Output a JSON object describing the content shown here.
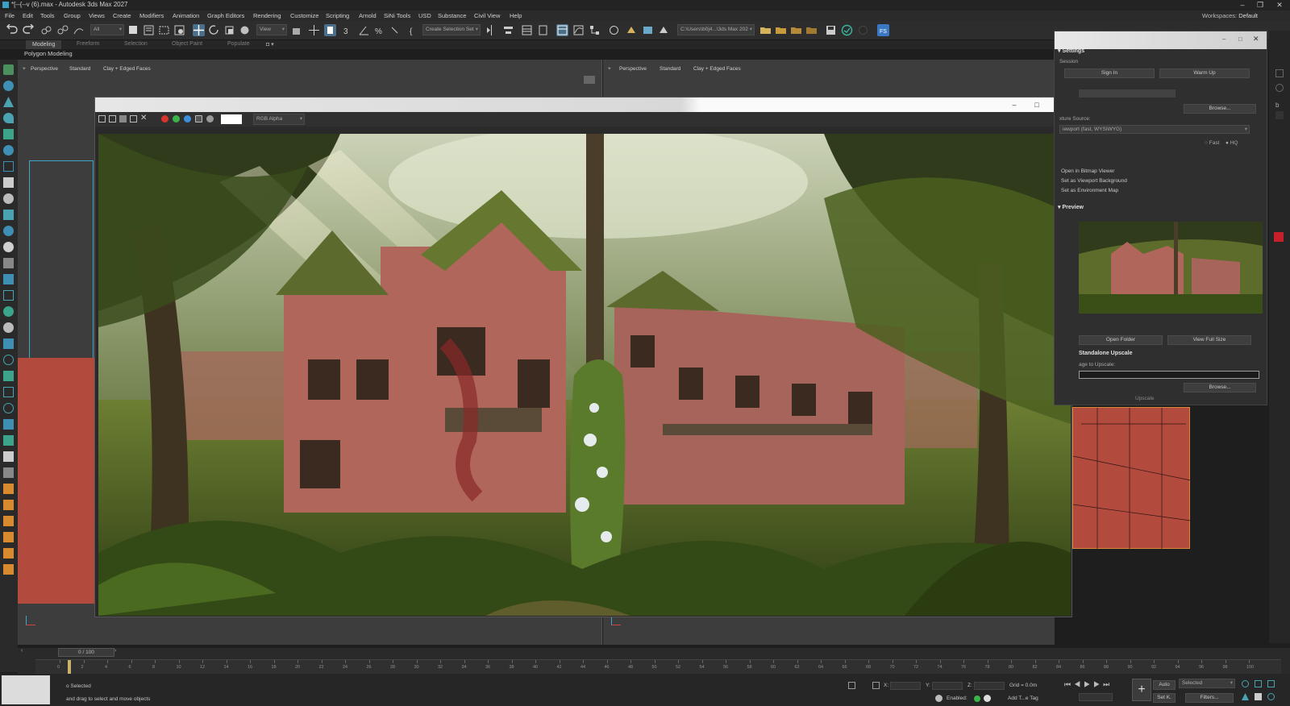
{
  "window": {
    "title": "*[--{--v (6).max - Autodesk 3ds Max 2027"
  },
  "menu": {
    "items": [
      "File",
      "Edit",
      "Tools",
      "Group",
      "Views",
      "Create",
      "Modifiers",
      "Animation",
      "Graph Editors",
      "Rendering",
      "Customize",
      "Scripting",
      "Arnold",
      "SiNi Tools",
      "USD",
      "Substance",
      "Civil View",
      "Help"
    ],
    "workspace_label": "Workspaces:",
    "workspace_value": "Default"
  },
  "toolbar": {
    "selection_filter": "All",
    "ref_coord": "View",
    "selection_set": "Create Selection Set",
    "project_path": "C:\\Users\\b0j4...\\3ds Max 202"
  },
  "ribbon": {
    "tabs": [
      "Modeling",
      "Freeform",
      "Selection",
      "Object Paint",
      "Populate"
    ],
    "active_tab": "Modeling",
    "panel_label": "Polygon Modeling"
  },
  "viewports": {
    "left": {
      "labels": [
        "+",
        "Perspective",
        "Standard",
        "Clay + Edged Faces"
      ]
    },
    "right": {
      "labels": [
        "+",
        "Perspective",
        "Standard",
        "Clay + Edged Faces"
      ]
    }
  },
  "render_window": {
    "channel": "RGB Alpha",
    "swatch_colors": [
      "#d9342b",
      "#3bb54a",
      "#3c8fd9",
      "#888888",
      "#cccccc"
    ]
  },
  "settings_panel": {
    "section_settings": "Settings",
    "session_label": "Session",
    "sign_in": "Sign In",
    "warm_up": "Warm Up",
    "browse_1": "Browse...",
    "texture_source_label": "xture Source:",
    "texture_source_value": "iewport (fast, WYSIWYG)",
    "quality_fast": "Fast",
    "quality_hq": "HQ",
    "link_bitmap": "Open in Bitmap Viewer",
    "link_viewport_bg": "Set as Viewport Background",
    "link_env_map": "Set as Environment Map",
    "section_preview": "Preview",
    "open_folder": "Open Folder",
    "view_full_size": "View Full Size",
    "section_upscale": "Standalone Upscale",
    "image_to_upscale_label": "age to Upscale:",
    "browse_2": "Browse...",
    "upscale_label": "Upscale"
  },
  "timeline": {
    "slider_text": "0 / 100",
    "ticks": [
      "0",
      "2",
      "4",
      "6",
      "8",
      "10",
      "12",
      "14",
      "16",
      "18",
      "20",
      "22",
      "24",
      "26",
      "28",
      "30",
      "32",
      "34",
      "36",
      "38",
      "40",
      "42",
      "44",
      "46",
      "48",
      "50",
      "52",
      "54",
      "56",
      "58",
      "60",
      "62",
      "64",
      "66",
      "68",
      "70",
      "72",
      "74",
      "76",
      "78",
      "80",
      "82",
      "84",
      "86",
      "88",
      "90",
      "92",
      "94",
      "96",
      "98",
      "100"
    ]
  },
  "status": {
    "selection": "o Selected",
    "prompt": "and drag to select and move objects",
    "x_label": "X:",
    "y_label": "Y:",
    "z_label": "Z:",
    "grid": "Grid = 0.0m",
    "enabled": "Enabled:",
    "add_time_tag": "Add T...e Tag",
    "auto_key": "Auto",
    "set_key": "Set K.",
    "selected_dd": "Selected",
    "filters": "Filters..."
  },
  "colors": {
    "accent_blue": "#3fa4c8",
    "object_red": "#b24a3e",
    "playhead": "#c9b26a"
  }
}
